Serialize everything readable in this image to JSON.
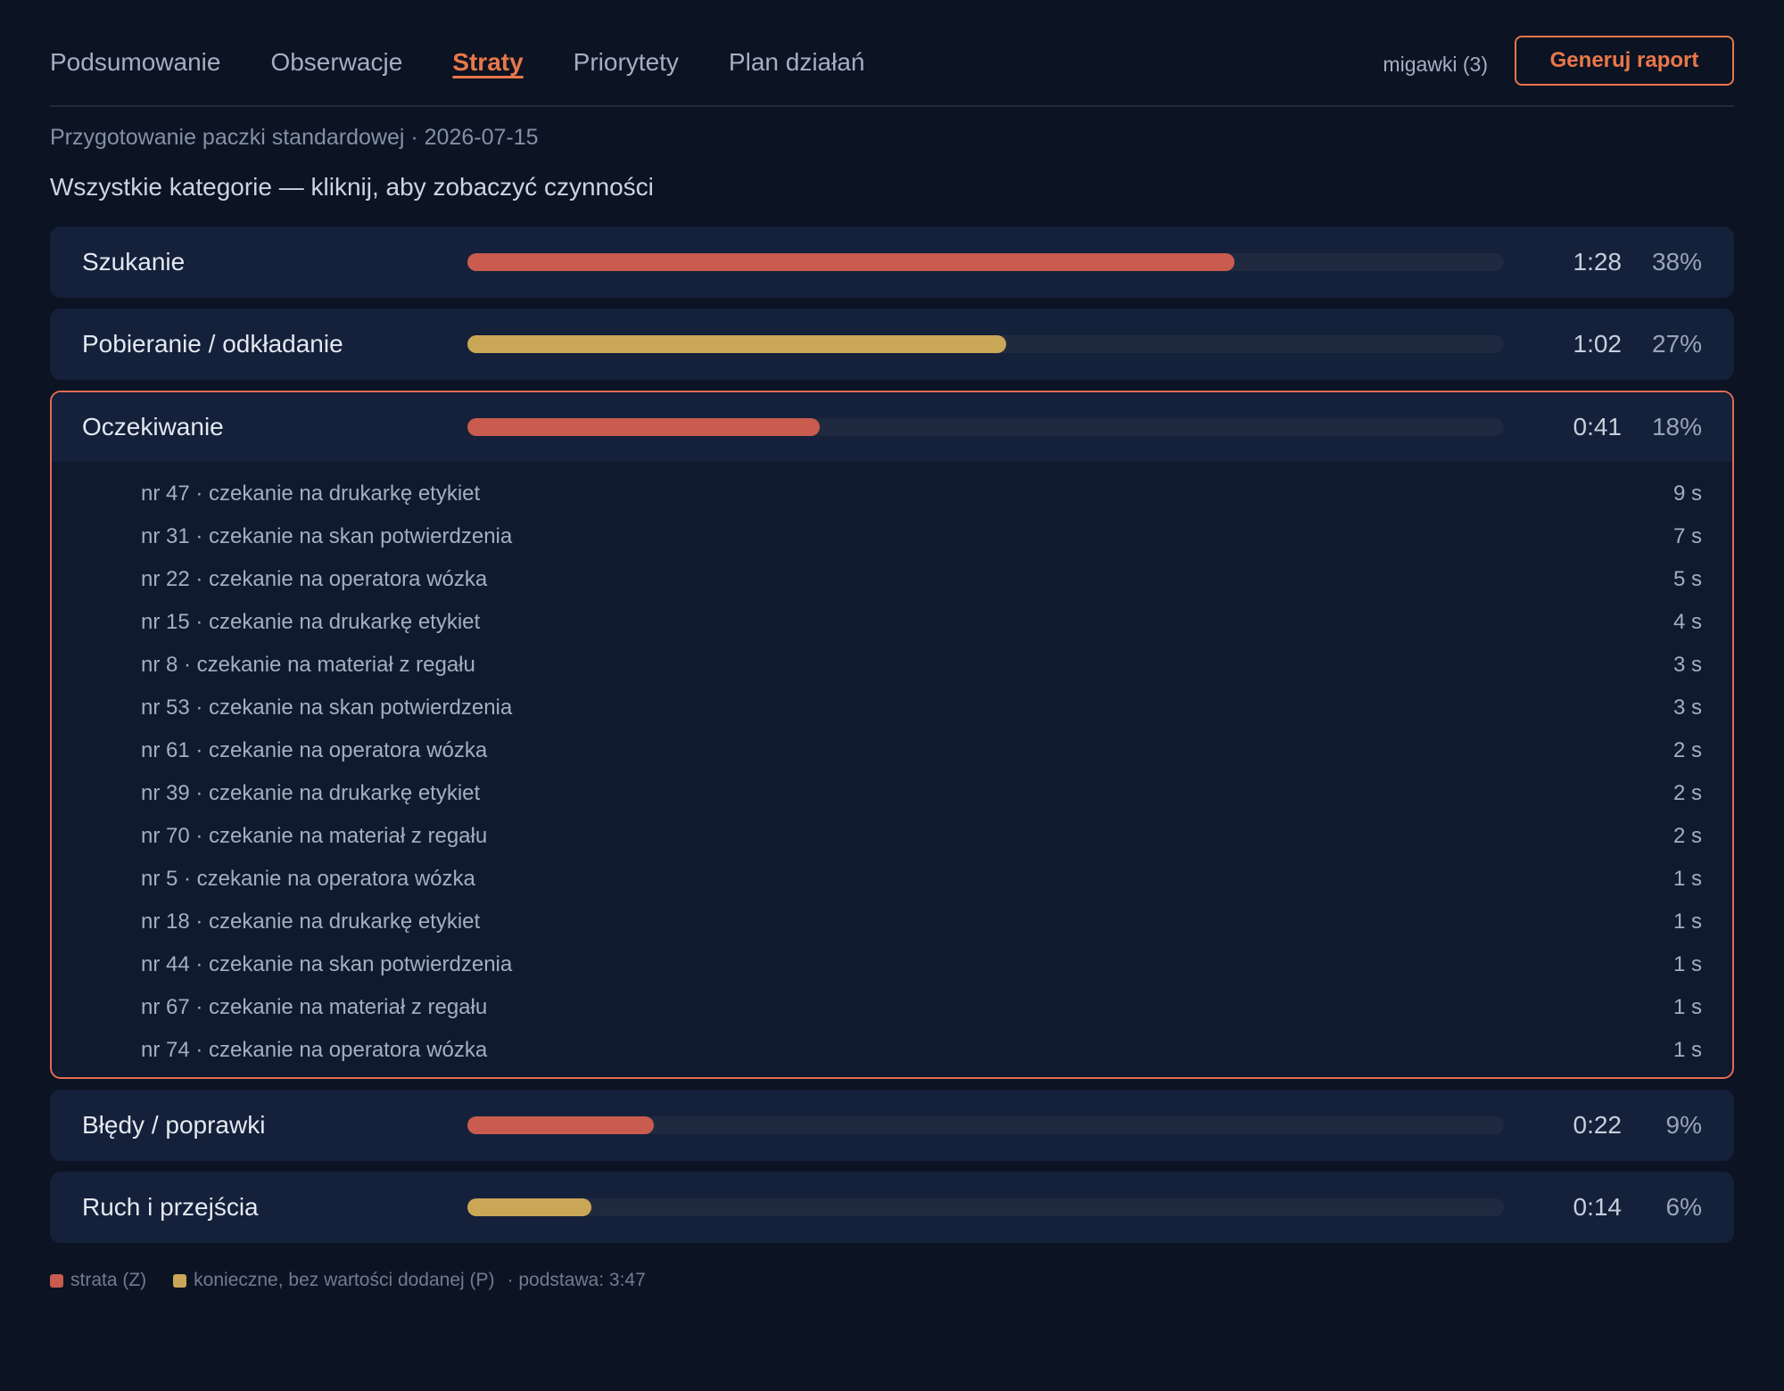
{
  "nav": {
    "tabs": [
      {
        "label": "Podsumowanie",
        "active": false
      },
      {
        "label": "Obserwacje",
        "active": false
      },
      {
        "label": "Straty",
        "active": true
      },
      {
        "label": "Priorytety",
        "active": false
      },
      {
        "label": "Plan działań",
        "active": false
      }
    ],
    "snapshots": "migawki (3)",
    "report_button": "Generuj raport"
  },
  "subtitle": "Przygotowanie paczki standardowej · 2026-07-15",
  "heading": "Wszystkie kategorie — kliknij, aby zobaczyć czynności",
  "colors": {
    "accent": "#e8774a",
    "waste": "#c95c4e",
    "necessary": "#c9a757"
  },
  "categories": [
    {
      "label": "Szukanie",
      "time": "1:28",
      "pct": "38%",
      "share": 0.74,
      "type": "z",
      "expanded": false
    },
    {
      "label": "Pobieranie / odkładanie",
      "time": "1:02",
      "pct": "27%",
      "share": 0.52,
      "type": "p",
      "expanded": false
    },
    {
      "label": "Oczekiwanie",
      "time": "0:41",
      "pct": "18%",
      "share": 0.34,
      "type": "z",
      "expanded": true,
      "items": [
        {
          "text": "nr 47 · czekanie na drukarkę etykiet",
          "dur": "9 s"
        },
        {
          "text": "nr 31 · czekanie na skan potwierdzenia",
          "dur": "7 s"
        },
        {
          "text": "nr 22 · czekanie na operatora wózka",
          "dur": "5 s"
        },
        {
          "text": "nr 15 · czekanie na drukarkę etykiet",
          "dur": "4 s"
        },
        {
          "text": "nr 8 · czekanie na materiał z regału",
          "dur": "3 s"
        },
        {
          "text": "nr 53 · czekanie na skan potwierdzenia",
          "dur": "3 s"
        },
        {
          "text": "nr 61 · czekanie na operatora wózka",
          "dur": "2 s"
        },
        {
          "text": "nr 39 · czekanie na drukarkę etykiet",
          "dur": "2 s"
        },
        {
          "text": "nr 70 · czekanie na materiał z regału",
          "dur": "2 s"
        },
        {
          "text": "nr 5 · czekanie na operatora wózka",
          "dur": "1 s"
        },
        {
          "text": "nr 18 · czekanie na drukarkę etykiet",
          "dur": "1 s"
        },
        {
          "text": "nr 44 · czekanie na skan potwierdzenia",
          "dur": "1 s"
        },
        {
          "text": "nr 67 · czekanie na materiał z regału",
          "dur": "1 s"
        },
        {
          "text": "nr 74 · czekanie na operatora wózka",
          "dur": "1 s"
        }
      ]
    },
    {
      "label": "Błędy / poprawki",
      "time": "0:22",
      "pct": "9%",
      "share": 0.18,
      "type": "z",
      "expanded": false
    },
    {
      "label": "Ruch i przejścia",
      "time": "0:14",
      "pct": "6%",
      "share": 0.12,
      "type": "p",
      "expanded": false
    }
  ],
  "legend": {
    "waste": "strata (Z)",
    "necessary": "konieczne, bez wartości dodanej (P)",
    "base": "· podstawa: 3:47"
  }
}
